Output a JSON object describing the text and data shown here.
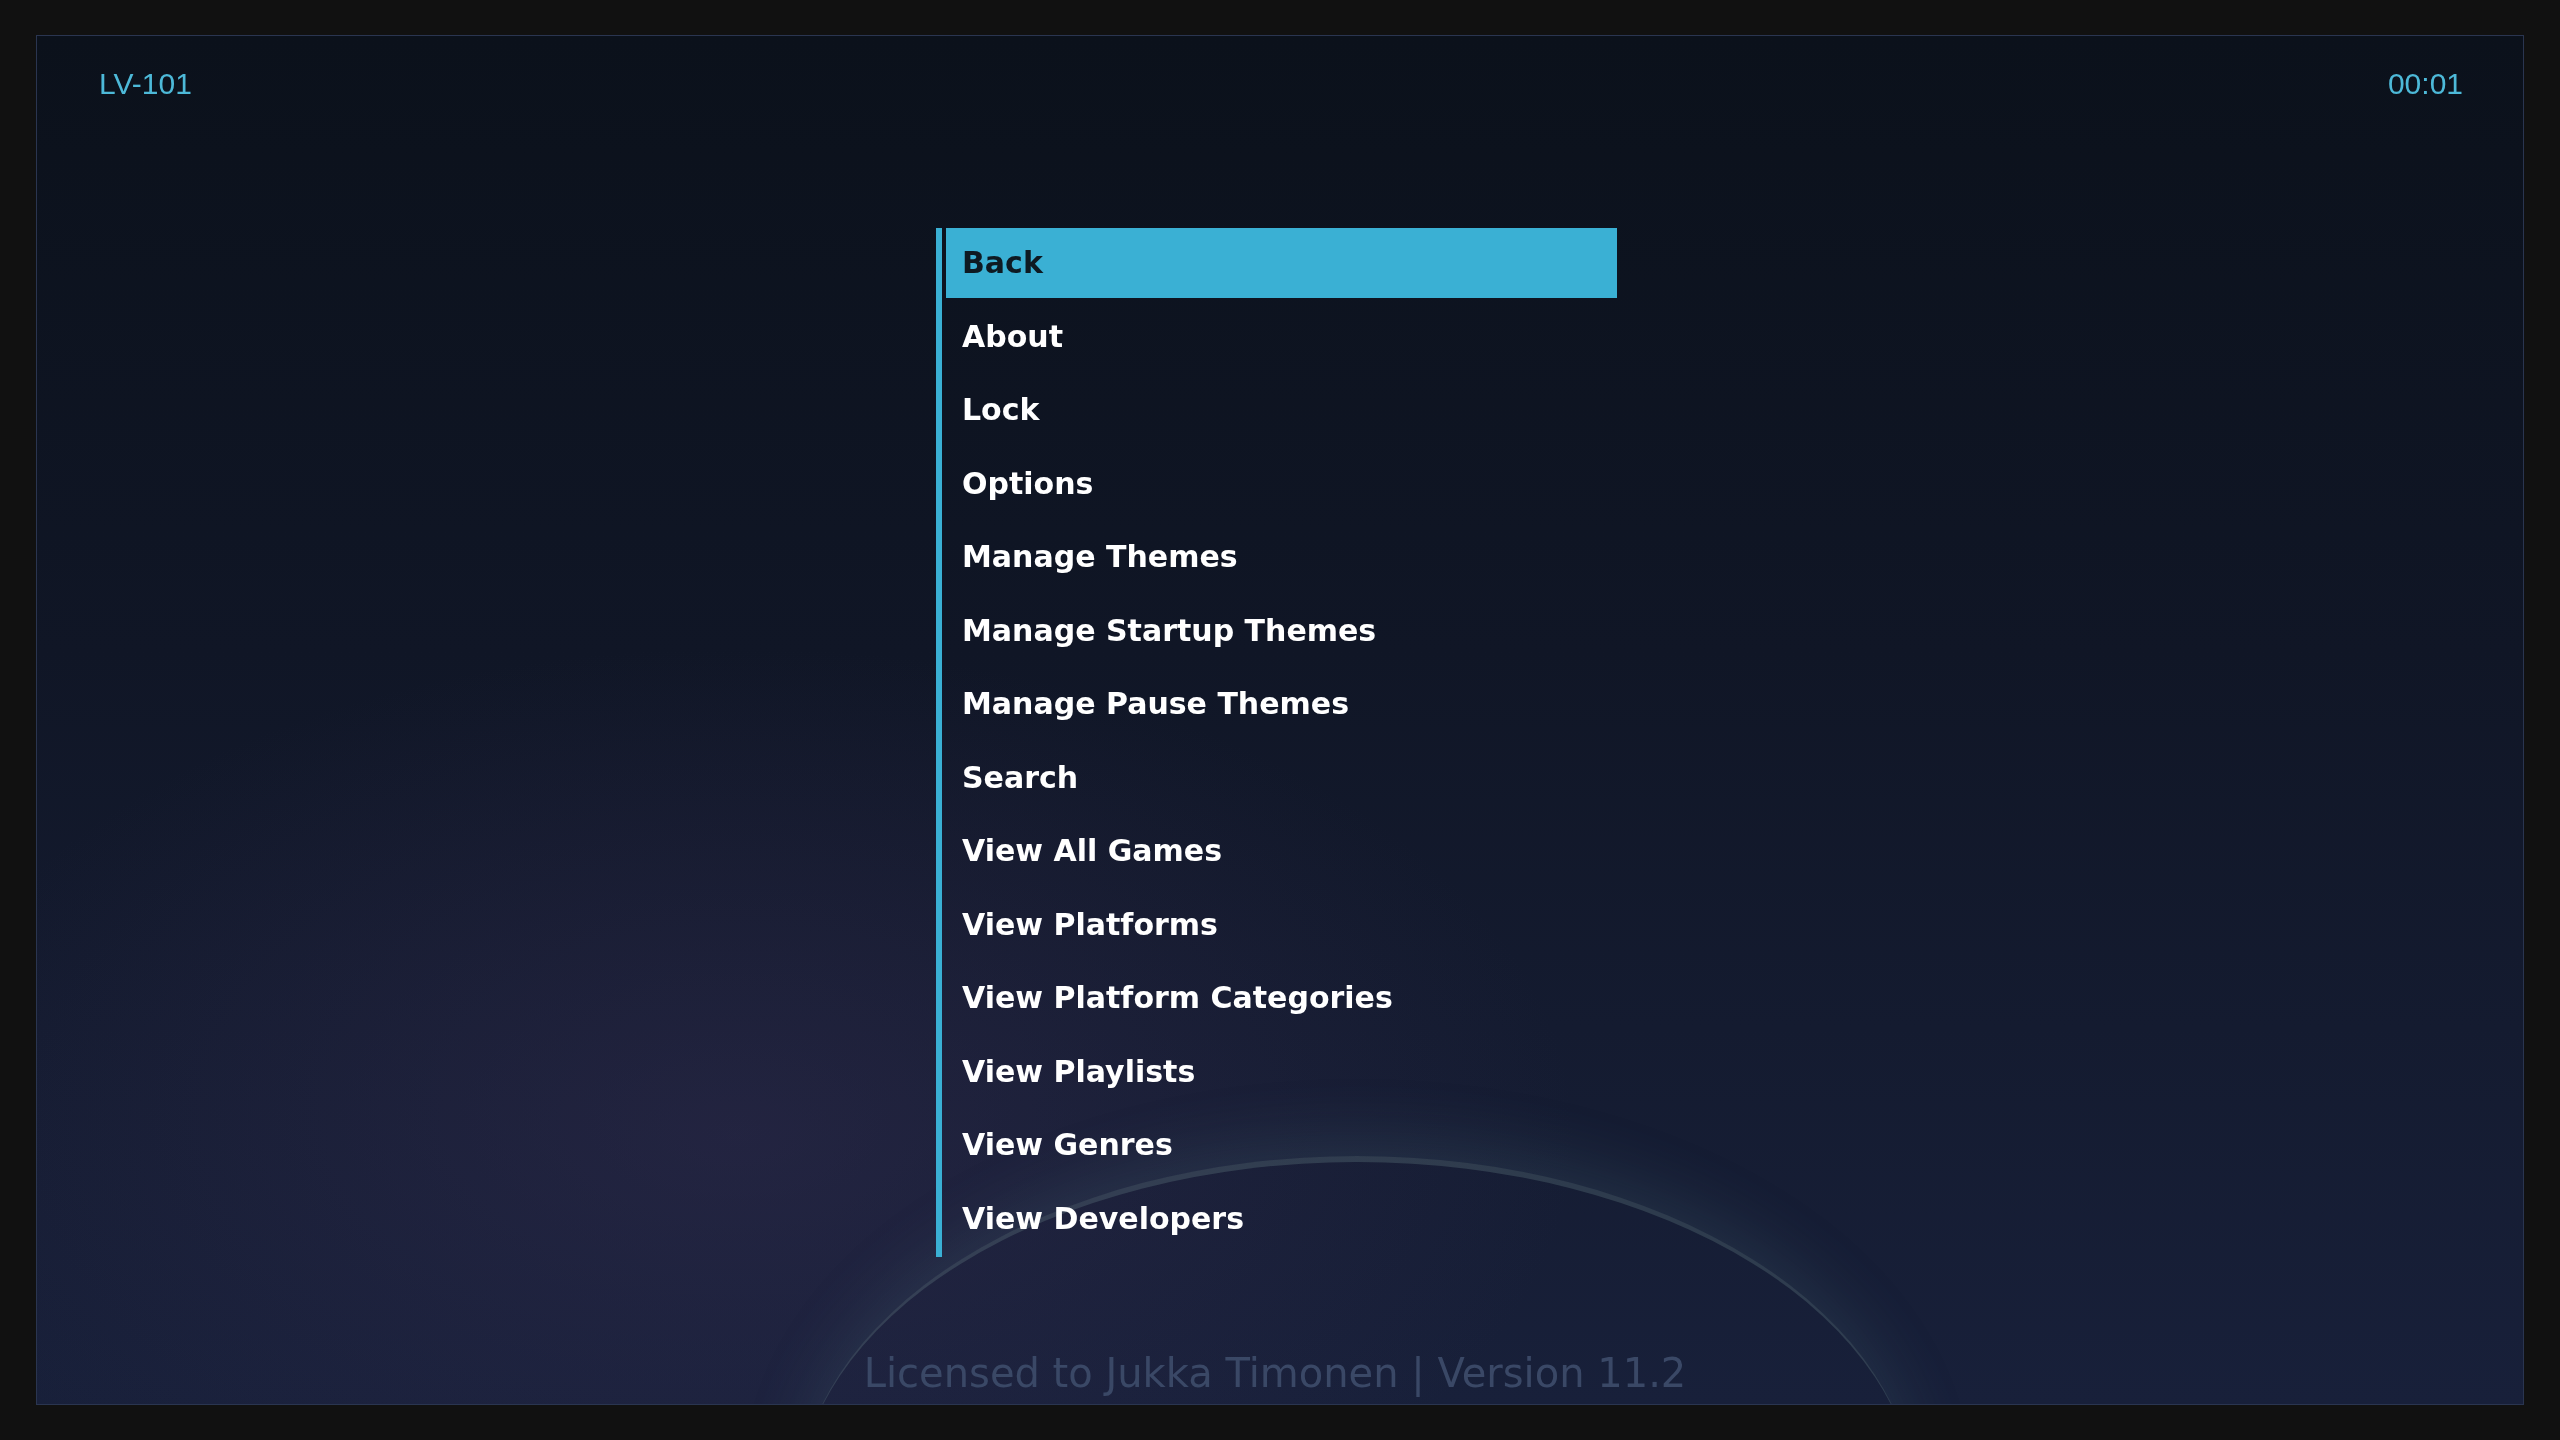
{
  "header": {
    "device_name": "LV-101",
    "clock": "00:01"
  },
  "menu": {
    "items": [
      {
        "label": "Back",
        "selected": true
      },
      {
        "label": "About",
        "selected": false
      },
      {
        "label": "Lock",
        "selected": false
      },
      {
        "label": "Options",
        "selected": false
      },
      {
        "label": "Manage Themes",
        "selected": false
      },
      {
        "label": "Manage Startup Themes",
        "selected": false
      },
      {
        "label": "Manage Pause Themes",
        "selected": false
      },
      {
        "label": "Search",
        "selected": false
      },
      {
        "label": "View All Games",
        "selected": false
      },
      {
        "label": "View Platforms",
        "selected": false
      },
      {
        "label": "View Platform Categories",
        "selected": false
      },
      {
        "label": "View Playlists",
        "selected": false
      },
      {
        "label": "View Genres",
        "selected": false
      },
      {
        "label": "View Developers",
        "selected": false
      }
    ]
  },
  "footer": {
    "license": "Licensed to Jukka Timonen | Version 11.2"
  }
}
